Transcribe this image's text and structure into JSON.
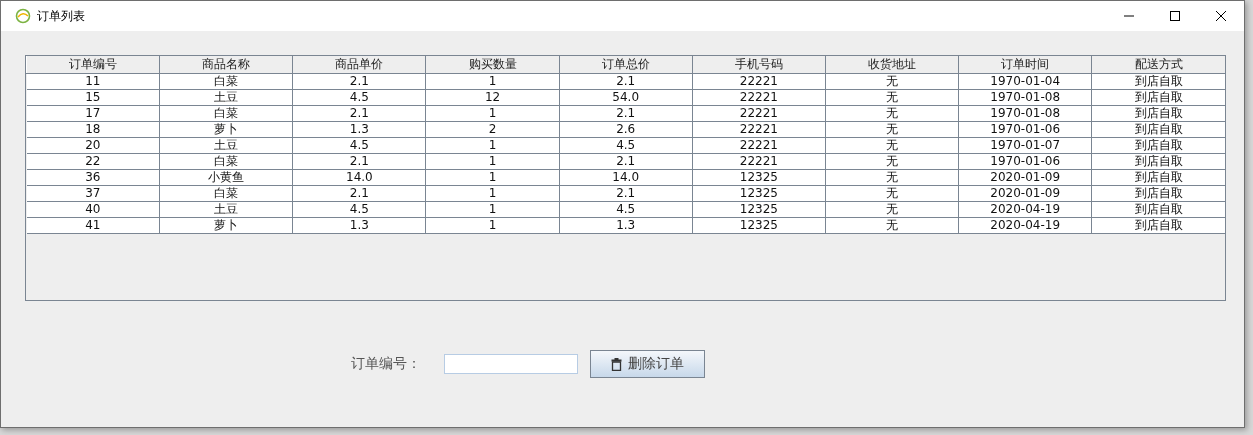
{
  "window": {
    "title": "订单列表"
  },
  "table": {
    "columns": [
      "订单编号",
      "商品名称",
      "商品单价",
      "购买数量",
      "订单总价",
      "手机号码",
      "收货地址",
      "订单时间",
      "配送方式"
    ],
    "rows": [
      [
        "11",
        "白菜",
        "2.1",
        "1",
        "2.1",
        "22221",
        "无",
        "1970-01-04",
        "到店自取"
      ],
      [
        "15",
        "土豆",
        "4.5",
        "12",
        "54.0",
        "22221",
        "无",
        "1970-01-08",
        "到店自取"
      ],
      [
        "17",
        "白菜",
        "2.1",
        "1",
        "2.1",
        "22221",
        "无",
        "1970-01-08",
        "到店自取"
      ],
      [
        "18",
        "萝卜",
        "1.3",
        "2",
        "2.6",
        "22221",
        "无",
        "1970-01-06",
        "到店自取"
      ],
      [
        "20",
        "土豆",
        "4.5",
        "1",
        "4.5",
        "22221",
        "无",
        "1970-01-07",
        "到店自取"
      ],
      [
        "22",
        "白菜",
        "2.1",
        "1",
        "2.1",
        "22221",
        "无",
        "1970-01-06",
        "到店自取"
      ],
      [
        "36",
        "小黄鱼",
        "14.0",
        "1",
        "14.0",
        "12325",
        "无",
        "2020-01-09",
        "到店自取"
      ],
      [
        "37",
        "白菜",
        "2.1",
        "1",
        "2.1",
        "12325",
        "无",
        "2020-01-09",
        "到店自取"
      ],
      [
        "40",
        "土豆",
        "4.5",
        "1",
        "4.5",
        "12325",
        "无",
        "2020-04-19",
        "到店自取"
      ],
      [
        "41",
        "萝卜",
        "1.3",
        "1",
        "1.3",
        "12325",
        "无",
        "2020-04-19",
        "到店自取"
      ]
    ]
  },
  "form": {
    "label": "订单编号：",
    "delete_button": "删除订单"
  }
}
